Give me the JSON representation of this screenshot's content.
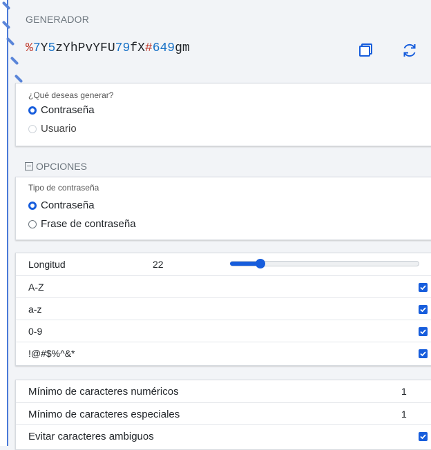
{
  "header": {
    "title": "GENERADOR"
  },
  "password": {
    "segments": [
      {
        "text": "%",
        "color": "#c0392b"
      },
      {
        "text": "7",
        "color": "#1a73c7"
      },
      {
        "text": "Y",
        "color": "#212529"
      },
      {
        "text": "5",
        "color": "#1a73c7"
      },
      {
        "text": "zYhPvYFU",
        "color": "#212529"
      },
      {
        "text": "79",
        "color": "#1a73c7"
      },
      {
        "text": "fX",
        "color": "#212529"
      },
      {
        "text": "#",
        "color": "#c0392b"
      },
      {
        "text": "649",
        "color": "#1a73c7"
      },
      {
        "text": "gm",
        "color": "#212529"
      }
    ],
    "copy_icon": "copy-icon",
    "regenerate_icon": "refresh-icon"
  },
  "generate_type": {
    "label": "¿Qué deseas generar?",
    "options": [
      {
        "label": "Contraseña",
        "selected": true,
        "disabled": false
      },
      {
        "label": "Usuario",
        "selected": false,
        "disabled": true
      }
    ]
  },
  "options_section": {
    "label": "OPCIONES",
    "expanded": true
  },
  "password_type": {
    "label": "Tipo de contraseña",
    "options": [
      {
        "label": "Contraseña",
        "selected": true
      },
      {
        "label": "Frase de contraseña",
        "selected": false
      }
    ]
  },
  "length": {
    "label": "Longitud",
    "value": "22",
    "slider_fraction": 0.16
  },
  "charsets": [
    {
      "label": "A-Z",
      "checked": true
    },
    {
      "label": "a-z",
      "checked": true
    },
    {
      "label": "0-9",
      "checked": true
    },
    {
      "label": "!@#$%^&*",
      "checked": true
    }
  ],
  "minimums": [
    {
      "label": "Mínimo de caracteres numéricos",
      "value": "1"
    },
    {
      "label": "Mínimo de caracteres especiales",
      "value": "1"
    }
  ],
  "avoid_ambiguous": {
    "label": "Evitar caracteres ambiguos",
    "checked": true
  },
  "colors": {
    "accent": "#175ddc",
    "special_char": "#c0392b",
    "digit": "#1a73c7"
  }
}
